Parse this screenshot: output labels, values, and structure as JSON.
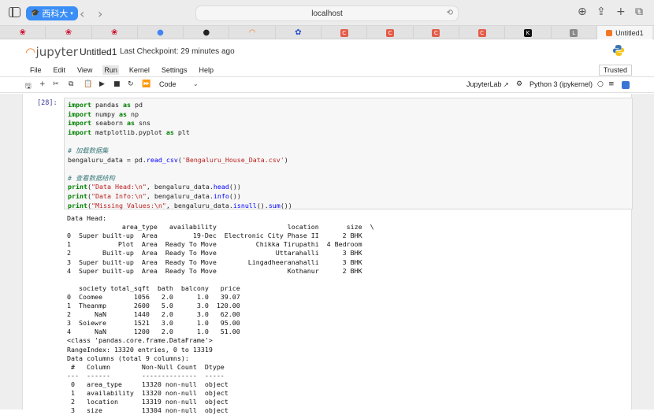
{
  "browser": {
    "profile_label": "西科大",
    "address": "localhost",
    "tabs": [
      {
        "icon": "huawei-icon",
        "color": "#cf0a2c",
        "glyph": "❀"
      },
      {
        "icon": "huawei-icon",
        "color": "#cf0a2c",
        "glyph": "❀"
      },
      {
        "icon": "huawei-icon",
        "color": "#cf0a2c",
        "glyph": "❀"
      },
      {
        "icon": "chrome-like-icon",
        "color": "#4285f4",
        "glyph": "●"
      },
      {
        "icon": "github-icon",
        "color": "#222222",
        "glyph": "●"
      },
      {
        "icon": "arc-icon",
        "color": "#f37726",
        "glyph": "◠"
      },
      {
        "icon": "paw-icon",
        "color": "#2b4ccf",
        "glyph": "✿"
      },
      {
        "icon": "c-icon",
        "color": "#e35d4a",
        "glyph": "C"
      },
      {
        "icon": "c-icon",
        "color": "#e35d4a",
        "glyph": "C"
      },
      {
        "icon": "c-icon",
        "color": "#e35d4a",
        "glyph": "C"
      },
      {
        "icon": "c-icon",
        "color": "#e35d4a",
        "glyph": "C"
      },
      {
        "icon": "k-icon",
        "color": "#111111",
        "glyph": "K"
      },
      {
        "icon": "l-icon",
        "color": "#8a8a8a",
        "glyph": "L"
      }
    ],
    "active_tab_title": "Untitled1"
  },
  "jupyter": {
    "logo_text": "jupyter",
    "notebook_title": "Untitled1",
    "checkpoint": "Last Checkpoint: 29 minutes ago",
    "menu": [
      "File",
      "Edit",
      "View",
      "Run",
      "Kernel",
      "Settings",
      "Help"
    ],
    "active_menu": "Run",
    "trusted": "Trusted",
    "cell_type": "Code",
    "jupyterlab_link": "JupyterLab",
    "kernel_name": "Python 3 (ipykernel)"
  },
  "cell": {
    "prompt": "[28]:",
    "code_lines": [
      [
        {
          "t": "import",
          "c": "kw"
        },
        {
          "t": " pandas ",
          "c": ""
        },
        {
          "t": "as",
          "c": "kw"
        },
        {
          "t": " pd",
          "c": ""
        }
      ],
      [
        {
          "t": "import",
          "c": "kw"
        },
        {
          "t": " numpy ",
          "c": ""
        },
        {
          "t": "as",
          "c": "kw"
        },
        {
          "t": " np",
          "c": ""
        }
      ],
      [
        {
          "t": "import",
          "c": "kw"
        },
        {
          "t": " seaborn ",
          "c": ""
        },
        {
          "t": "as",
          "c": "kw"
        },
        {
          "t": " sns",
          "c": ""
        }
      ],
      [
        {
          "t": "import",
          "c": "kw"
        },
        {
          "t": " matplotlib.pyplot ",
          "c": ""
        },
        {
          "t": "as",
          "c": "kw"
        },
        {
          "t": " plt",
          "c": ""
        }
      ],
      [],
      [
        {
          "t": "# 加载数据集",
          "c": "cm"
        }
      ],
      [
        {
          "t": "bengaluru_data = pd.",
          "c": ""
        },
        {
          "t": "read_csv",
          "c": "fn"
        },
        {
          "t": "(",
          "c": ""
        },
        {
          "t": "'Bengaluru_House_Data.csv'",
          "c": "st"
        },
        {
          "t": ")",
          "c": ""
        }
      ],
      [],
      [
        {
          "t": "# 查看数据结构",
          "c": "cm"
        }
      ],
      [
        {
          "t": "print",
          "c": "kw"
        },
        {
          "t": "(",
          "c": ""
        },
        {
          "t": "\"Data Head:\\n\"",
          "c": "st"
        },
        {
          "t": ", bengaluru_data.",
          "c": ""
        },
        {
          "t": "head",
          "c": "fn"
        },
        {
          "t": "())",
          "c": ""
        }
      ],
      [
        {
          "t": "print",
          "c": "kw"
        },
        {
          "t": "(",
          "c": ""
        },
        {
          "t": "\"Data Info:\\n\"",
          "c": "st"
        },
        {
          "t": ", bengaluru_data.",
          "c": ""
        },
        {
          "t": "info",
          "c": "fn"
        },
        {
          "t": "())",
          "c": ""
        }
      ],
      [
        {
          "t": "print",
          "c": "kw"
        },
        {
          "t": "(",
          "c": ""
        },
        {
          "t": "\"Missing Values:\\n\"",
          "c": "st"
        },
        {
          "t": ", bengaluru_data.",
          "c": ""
        },
        {
          "t": "isnull",
          "c": "fn"
        },
        {
          "t": "().",
          "c": ""
        },
        {
          "t": "sum",
          "c": "fn"
        },
        {
          "t": "())",
          "c": ""
        }
      ]
    ],
    "output_lines": [
      "Data Head:",
      "              area_type   availability                  location       size  \\",
      "0  Super built-up  Area         19-Dec  Electronic City Phase II      2 BHK",
      "1            Plot  Area  Ready To Move          Chikka Tirupathi  4 Bedroom",
      "2        Built-up  Area  Ready To Move               Uttarahalli      3 BHK",
      "3  Super built-up  Area  Ready To Move        Lingadheeranahalli      3 BHK",
      "4  Super built-up  Area  Ready To Move                  Kothanur      2 BHK",
      "",
      "   society total_sqft  bath  balcony   price",
      "0  Coomee        1056   2.0      1.0   39.07",
      "1  Theanmp       2600   5.0      3.0  120.00",
      "2      NaN       1440   2.0      3.0   62.00",
      "3  Soiewre       1521   3.0      1.0   95.00",
      "4      NaN       1200   2.0      1.0   51.00",
      "<class 'pandas.core.frame.DataFrame'>",
      "RangeIndex: 13320 entries, 0 to 13319",
      "Data columns (total 9 columns):",
      " #   Column        Non-Null Count  Dtype  ",
      "---  ------        --------------  -----  ",
      " 0   area_type     13320 non-null  object ",
      " 1   availability  13320 non-null  object ",
      " 2   location      13319 non-null  object ",
      " 3   size          13304 non-null  object "
    ]
  }
}
